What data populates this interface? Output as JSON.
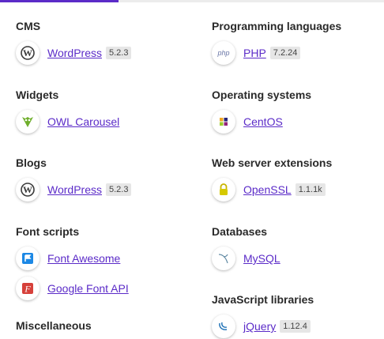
{
  "categories_left": [
    {
      "title": "CMS",
      "items": [
        {
          "name": "WordPress",
          "version": "5.2.3",
          "icon": "wordpress-icon"
        }
      ]
    },
    {
      "title": "Widgets",
      "items": [
        {
          "name": "OWL Carousel",
          "version": null,
          "icon": "owl-carousel-icon"
        }
      ]
    },
    {
      "title": "Blogs",
      "items": [
        {
          "name": "WordPress",
          "version": "5.2.3",
          "icon": "wordpress-icon"
        }
      ]
    },
    {
      "title": "Font scripts",
      "items": [
        {
          "name": "Font Awesome",
          "version": null,
          "icon": "font-awesome-icon"
        },
        {
          "name": "Google Font API",
          "version": null,
          "icon": "google-font-api-icon"
        }
      ]
    },
    {
      "title": "Miscellaneous",
      "items": []
    }
  ],
  "categories_right": [
    {
      "title": "Programming languages",
      "items": [
        {
          "name": "PHP",
          "version": "7.2.24",
          "icon": "php-icon"
        }
      ]
    },
    {
      "title": "Operating systems",
      "items": [
        {
          "name": "CentOS",
          "version": null,
          "icon": "centos-icon"
        }
      ]
    },
    {
      "title": "Web server extensions",
      "items": [
        {
          "name": "OpenSSL",
          "version": "1.1.1k",
          "icon": "openssl-icon"
        }
      ]
    },
    {
      "title": "Databases",
      "items": [
        {
          "name": "MySQL",
          "version": null,
          "icon": "mysql-icon"
        }
      ]
    },
    {
      "title": "JavaScript libraries",
      "items": [
        {
          "name": "jQuery",
          "version": "1.12.4",
          "icon": "jquery-icon"
        }
      ]
    }
  ],
  "colors": {
    "accent": "#5b2bc8",
    "badge_bg": "#e6e6e6"
  }
}
